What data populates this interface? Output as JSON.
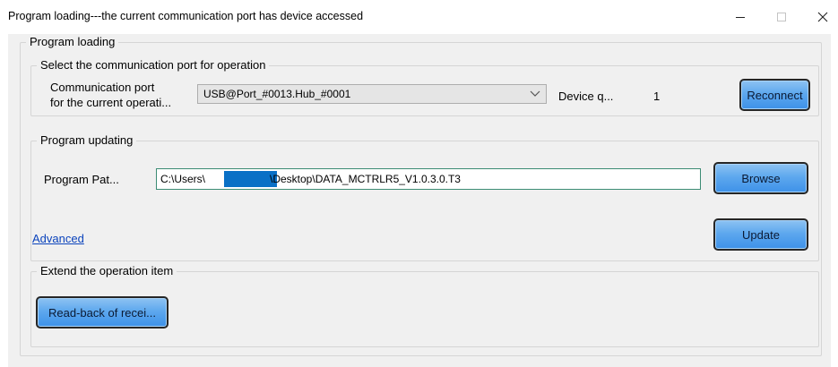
{
  "window": {
    "title": "Program loading---the current communication port has device accessed",
    "minimize_glyph": "—",
    "maximize_glyph": "☐",
    "close_glyph": "✕"
  },
  "program_loading": {
    "legend": "Program loading",
    "port_group": {
      "legend": "Select the communication port for operation",
      "port_label_line1": "Communication port",
      "port_label_line2": "for the current operati...",
      "port_value": "USB@Port_#0013.Hub_#0001",
      "device_label": "Device q...",
      "device_count": "1",
      "reconnect_label": "Reconnect"
    },
    "update_group": {
      "legend": "Program updating",
      "path_label": "Program Pat...",
      "path_prefix": "C:\\Users\\",
      "path_suffix": "\\Desktop\\DATA_MCTRLR5_V1.0.3.0.T3",
      "browse_label": "Browse",
      "advanced_link": "Advanced",
      "update_label": "Update"
    },
    "extend_group": {
      "legend": "Extend the operation item",
      "readback_label": "Read-back of recei..."
    }
  },
  "icons": {
    "combo_arrow": "chevron-down-icon",
    "redaction": "redaction-mask"
  },
  "colors": {
    "button_blue": "#5ea8ee",
    "redaction_blue": "#0a70c6",
    "link_blue": "#0b43bc",
    "dialog_bg": "#f0f0f0"
  }
}
